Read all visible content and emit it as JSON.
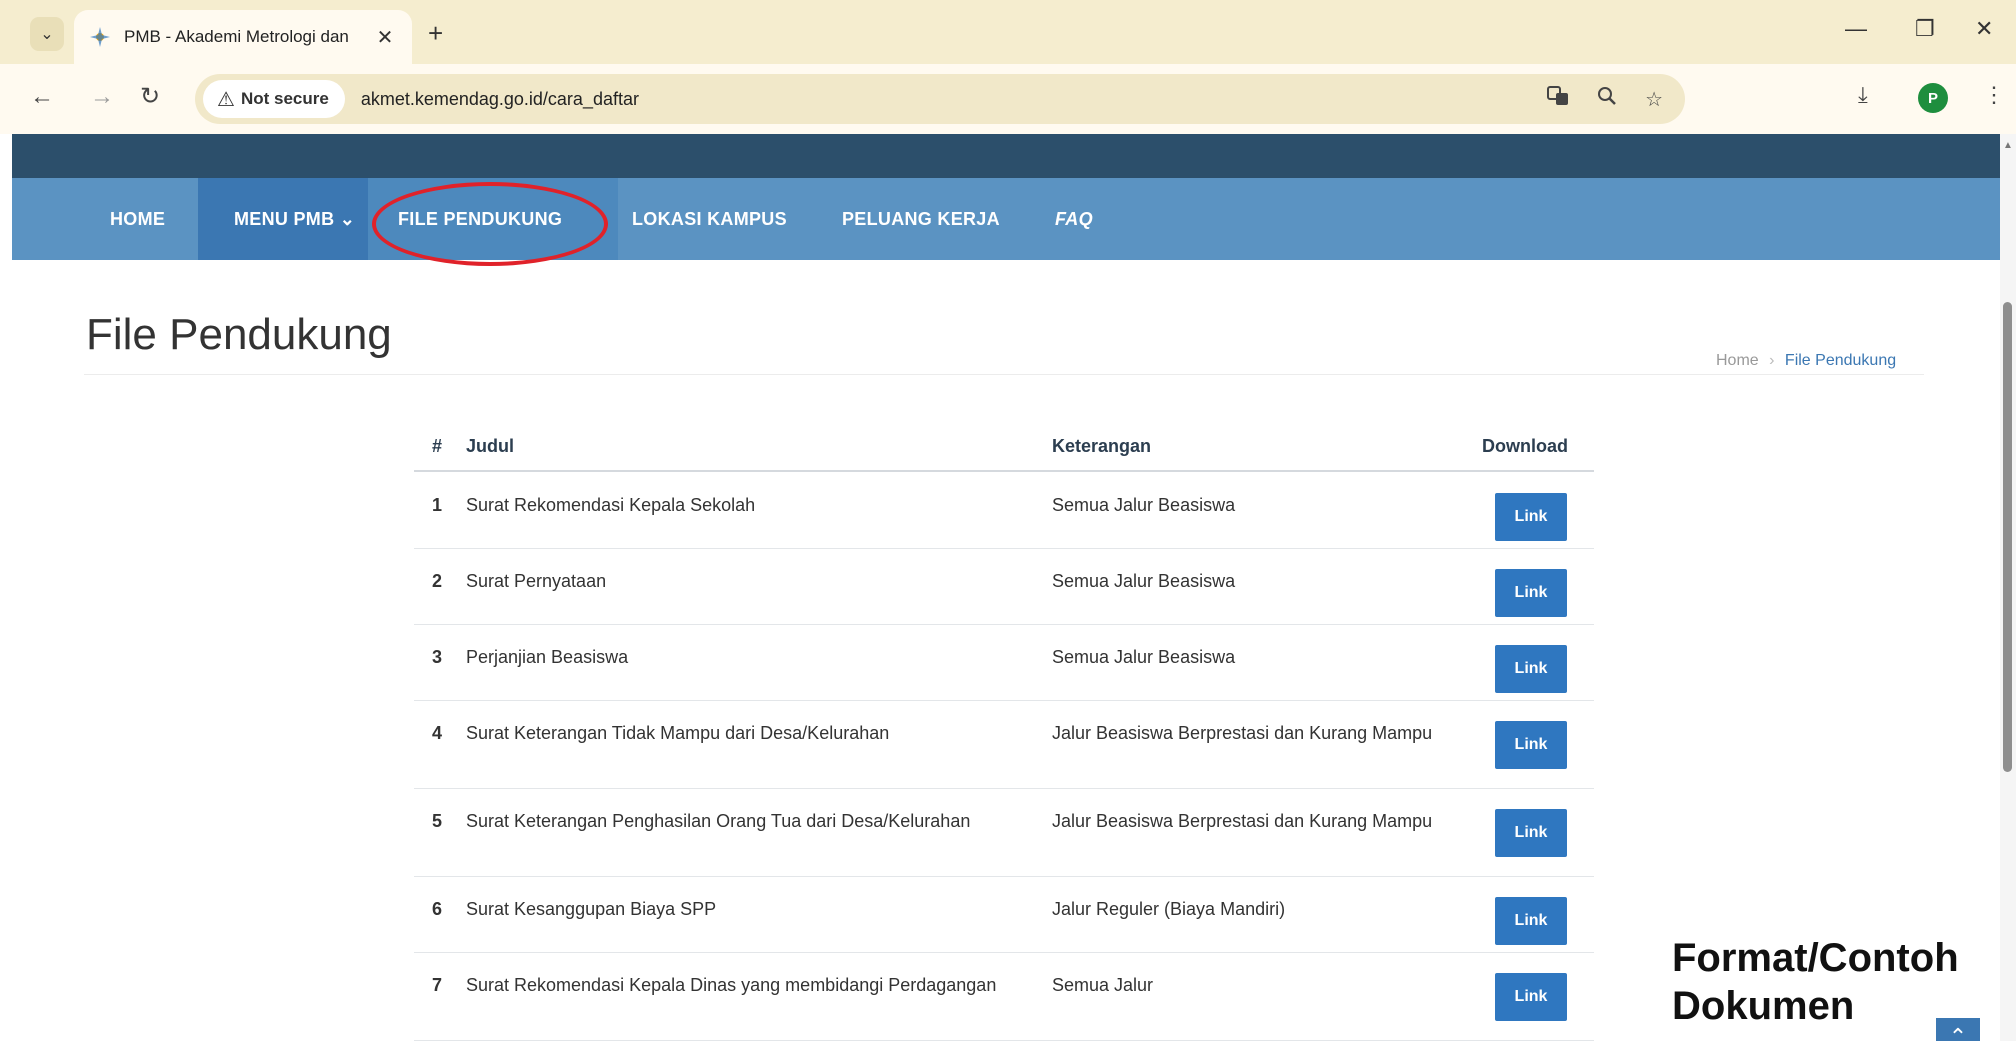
{
  "browser": {
    "tab_title": "PMB - Akademi Metrologi dan",
    "security_label": "Not secure",
    "url": "akmet.kemendag.go.id/cara_daftar",
    "profile_initial": "P"
  },
  "nav": {
    "items": [
      {
        "label": "HOME"
      },
      {
        "label": "MENU PMB ⌄"
      },
      {
        "label": "FILE PENDUKUNG"
      },
      {
        "label": "LOKASI KAMPUS"
      },
      {
        "label": "PELUANG KERJA"
      },
      {
        "label": "FAQ"
      }
    ],
    "highlight_color": "#e0222a"
  },
  "page": {
    "title": "File Pendukung",
    "breadcrumb": {
      "home": "Home",
      "separator": "›",
      "current": "File Pendukung"
    }
  },
  "table": {
    "headers": {
      "num": "#",
      "judul": "Judul",
      "keterangan": "Keterangan",
      "download": "Download"
    },
    "rows": [
      {
        "num": "1",
        "judul": "Surat Rekomendasi Kepala Sekolah",
        "keterangan": "Semua Jalur Beasiswa",
        "download": "Link"
      },
      {
        "num": "2",
        "judul": "Surat Pernyataan",
        "keterangan": "Semua Jalur Beasiswa",
        "download": "Link"
      },
      {
        "num": "3",
        "judul": "Perjanjian Beasiswa",
        "keterangan": "Semua Jalur Beasiswa",
        "download": "Link"
      },
      {
        "num": "4",
        "judul": "Surat Keterangan Tidak Mampu dari Desa/Kelurahan",
        "keterangan": "Jalur Beasiswa Berprestasi dan Kurang Mampu",
        "download": "Link"
      },
      {
        "num": "5",
        "judul": "Surat Keterangan Penghasilan Orang Tua dari Desa/Kelurahan",
        "keterangan": "Jalur Beasiswa Berprestasi dan Kurang Mampu",
        "download": "Link"
      },
      {
        "num": "6",
        "judul": "Surat Kesanggupan Biaya SPP",
        "keterangan": "Jalur Reguler (Biaya Mandiri)",
        "download": "Link"
      },
      {
        "num": "7",
        "judul": "Surat Rekomendasi Kepala Dinas yang membidangi Perdagangan",
        "keterangan": "Semua Jalur",
        "download": "Link"
      }
    ]
  },
  "annotation": {
    "line1": "Format/Contoh",
    "line2": "Dokumen"
  },
  "colors": {
    "topstrip": "#2c4f6b",
    "navbar": "#5b93c2",
    "nav_active": "#3b77b2",
    "link_button": "#2f77c0"
  }
}
